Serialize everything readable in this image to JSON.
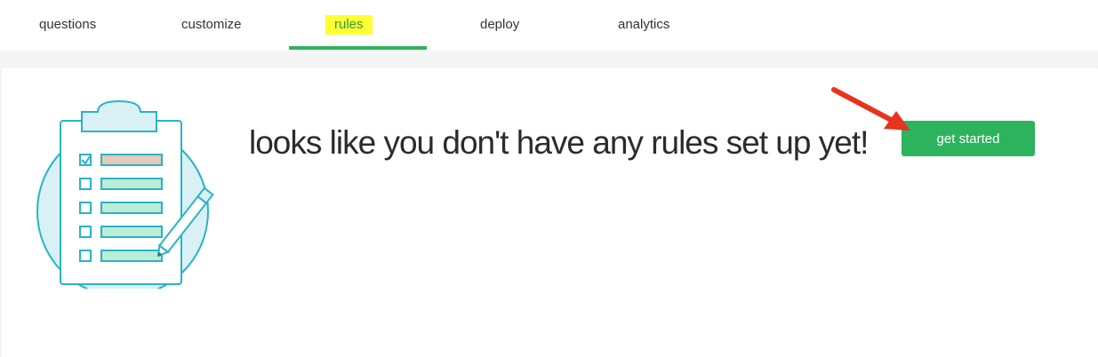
{
  "tabs": [
    {
      "label": "questions",
      "active": false
    },
    {
      "label": "customize",
      "active": false
    },
    {
      "label": "rules",
      "active": true
    },
    {
      "label": "deploy",
      "active": false
    },
    {
      "label": "analytics",
      "active": false
    }
  ],
  "empty_state": {
    "message": "looks like you don't have any rules set up yet!",
    "cta_label": "get started",
    "illustration_icon": "clipboard-checklist-icon"
  },
  "colors": {
    "accent": "#2db35d",
    "highlight": "#ffff33",
    "annotation_arrow": "#e8331d"
  }
}
